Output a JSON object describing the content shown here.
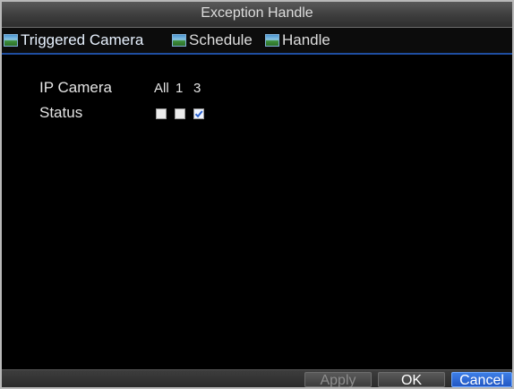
{
  "window": {
    "title": "Exception Handle"
  },
  "tabs": [
    {
      "label": "Triggered Camera"
    },
    {
      "label": "Schedule"
    },
    {
      "label": "Handle"
    }
  ],
  "form": {
    "ip_camera_label": "IP Camera",
    "status_label": "Status",
    "camera_columns": [
      "All",
      "1",
      "3"
    ],
    "camera_checked": [
      false,
      false,
      true
    ]
  },
  "buttons": {
    "apply": "Apply",
    "ok": "OK",
    "cancel": "Cancel"
  },
  "colors": {
    "accent": "#2a62d1",
    "background": "#000000",
    "title_bar": "#4a4a4a"
  }
}
